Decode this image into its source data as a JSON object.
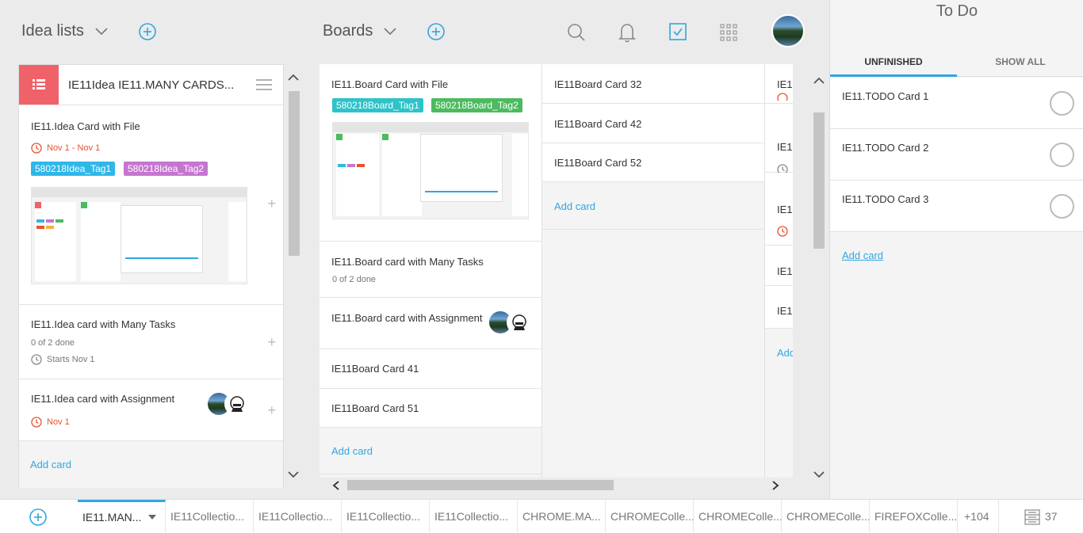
{
  "header": {
    "idea_lists_label": "Idea lists",
    "boards_label": "Boards"
  },
  "idea_list": {
    "title": "IE11Idea IE11.MANY CARDS...",
    "cards": [
      {
        "title": "IE11.Idea Card with File",
        "date": "Nov 1 - Nov 1",
        "tags": [
          {
            "label": "580218Idea_Tag1",
            "color": "#2fb7e8"
          },
          {
            "label": "580218Idea_Tag2",
            "color": "#c576cf"
          }
        ]
      },
      {
        "title": "IE11.Idea card with Many Tasks",
        "tasks": "0 of 2 done",
        "starts": "Starts Nov 1"
      },
      {
        "title": "IE11.Idea card with Assignment",
        "date": "Nov 1"
      }
    ],
    "add_card": "Add card"
  },
  "board_col1": {
    "cards": [
      {
        "title": "IE11.Board Card with File",
        "tags": [
          {
            "label": "580218Board_Tag1",
            "color": "#2dc3c9"
          },
          {
            "label": "580218Board_Tag2",
            "color": "#4cbb5f"
          }
        ]
      },
      {
        "title": "IE11.Board card with Many Tasks",
        "tasks": "0 of 2 done"
      },
      {
        "title": "IE11.Board card with Assignment"
      },
      {
        "title": "IE11Board Card 41"
      },
      {
        "title": "IE11Board Card 51"
      }
    ],
    "add_card": "Add card"
  },
  "board_col2": {
    "cards": [
      "IE11Board Card 32",
      "IE11Board Card 42",
      "IE11Board Card 52"
    ],
    "add_card": "Add card"
  },
  "board_col3": {
    "cards": [
      "IE1",
      "IE1",
      "IE1",
      "IE1",
      "IE1"
    ],
    "add_card": "Add"
  },
  "todo": {
    "title": "To Do",
    "tab_unfinished": "UNFINISHED",
    "tab_show_all": "SHOW ALL",
    "items": [
      "IE11.TODO Card 1",
      "IE11.TODO Card 2",
      "IE11.TODO Card 3"
    ],
    "add_card": "Add card"
  },
  "bottom_tabs": {
    "tabs": [
      "IE11.MAN...",
      "IE11Collectio...",
      "IE11Collectio...",
      "IE11Collectio...",
      "IE11Collectio...",
      "CHROME.MA...",
      "CHROMEColle...",
      "CHROMEColle...",
      "CHROMEColle...",
      "FIREFOXColle..."
    ],
    "more": "+104",
    "count": "37"
  },
  "colors": {
    "accent": "#2fa7e0",
    "idea_icon_bg": "#f0626a",
    "date_red": "#e8532e"
  }
}
